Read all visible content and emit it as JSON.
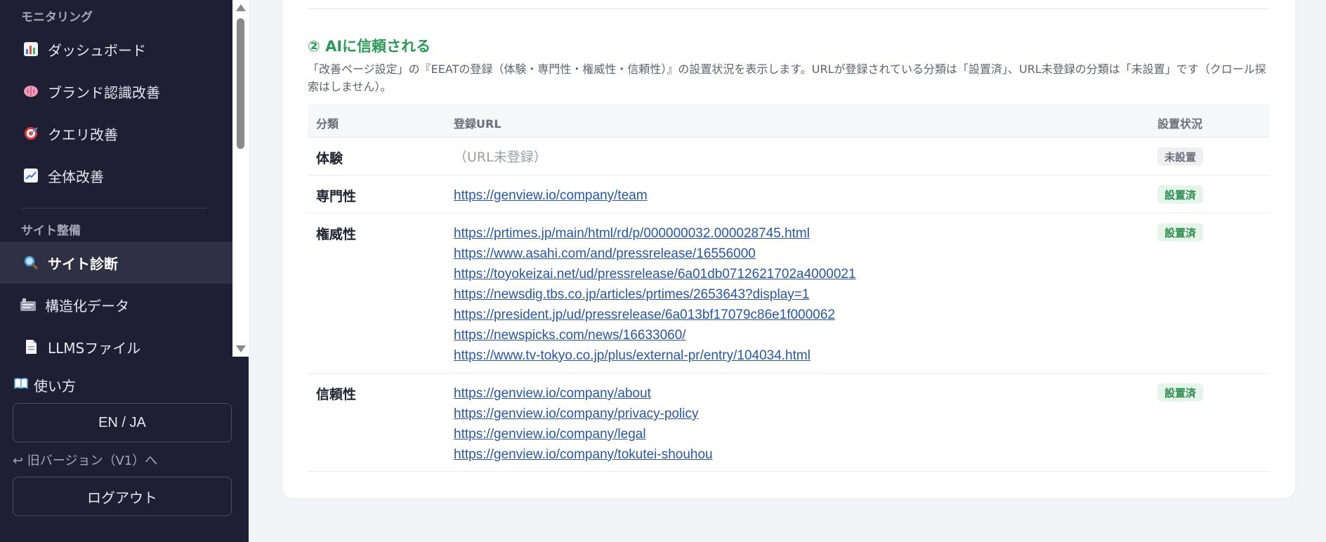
{
  "sidebar": {
    "section_monitoring": "モニタリング",
    "monitoring_items": [
      {
        "label": "ダッシュボード",
        "icon": "bar-chart-icon"
      },
      {
        "label": "ブランド認識改善",
        "icon": "brain-icon"
      },
      {
        "label": "クエリ改善",
        "icon": "target-icon"
      },
      {
        "label": "全体改善",
        "icon": "trend-up-icon"
      }
    ],
    "section_site": "サイト整備",
    "site_items": [
      {
        "label": "サイト診断",
        "icon": "magnifier-icon",
        "active": true
      },
      {
        "label": "構造化データ",
        "icon": "structured-data-icon"
      },
      {
        "label": "LLMSファイル",
        "icon": "document-icon"
      }
    ],
    "howto_label": "使い方",
    "lang_toggle": "EN / JA",
    "legacy_link": "↩ 旧バージョン（V1）へ",
    "logout_label": "ログアウト"
  },
  "section": {
    "heading": "② AIに信頼される",
    "description": "「改善ページ設定」の『EEATの登録（体験・専門性・権威性・信頼性）』の設置状況を表示します。URLが登録されている分類は「設置済」、URL未登録の分類は「未設置」です（クロール探索はしません）。"
  },
  "table": {
    "headers": {
      "category": "分類",
      "url": "登録URL",
      "status": "設置状況"
    },
    "rows": [
      {
        "category": "体験",
        "urls": [],
        "empty_text": "（URL未登録）",
        "status": "未設置"
      },
      {
        "category": "専門性",
        "urls": [
          "https://genview.io/company/team"
        ],
        "status": "設置済"
      },
      {
        "category": "権威性",
        "urls": [
          "https://prtimes.jp/main/html/rd/p/000000032.000028745.html",
          "https://www.asahi.com/and/pressrelease/16556000",
          "https://toyokeizai.net/ud/pressrelease/6a01db0712621702a4000021",
          "https://newsdig.tbs.co.jp/articles/prtimes/2653643?display=1",
          "https://president.jp/ud/pressrelease/6a013bf17079c86e1f000062",
          "https://newspicks.com/news/16633060/",
          "https://www.tv-tokyo.co.jp/plus/external-pr/entry/104034.html"
        ],
        "status": "設置済"
      },
      {
        "category": "信頼性",
        "urls": [
          "https://genview.io/company/about",
          "https://genview.io/company/privacy-policy",
          "https://genview.io/company/legal",
          "https://genview.io/company/tokutei-shouhou"
        ],
        "status": "設置済"
      }
    ]
  },
  "colors": {
    "accent_green": "#2b9a57",
    "sidebar_bg": "#1e1f33",
    "link": "#2756a8"
  }
}
